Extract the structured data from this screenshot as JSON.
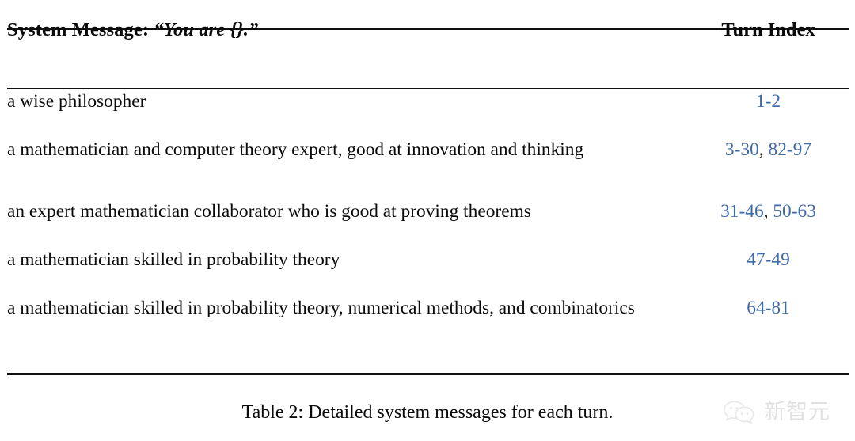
{
  "figure": {
    "caption": "Table 2: Detailed system messages for each turn.",
    "accent_color": "#3f6aa8",
    "rule_color": "#101010"
  },
  "table": {
    "headers": {
      "message_prefix": "System Message: ",
      "message_quoted": "“You are {}.”",
      "turn_index": "Turn Index"
    },
    "rows": [
      {
        "message": "a wise philosopher",
        "turn_index": "1-2",
        "turn_parts": [
          {
            "text": "1-2",
            "link": true
          }
        ]
      },
      {
        "message": "a mathematician and computer theory expert, good at innovation and thinking",
        "turn_index": "3-30, 82-97",
        "turn_parts": [
          {
            "text": "3-30",
            "link": true
          },
          {
            "text": ", ",
            "link": false
          },
          {
            "text": "82-97",
            "link": true
          }
        ]
      },
      {
        "message": "an expert mathematician collaborator who is good at proving theorems",
        "turn_index": "31-46, 50-63",
        "turn_parts": [
          {
            "text": "31-46",
            "link": true
          },
          {
            "text": ", ",
            "link": false
          },
          {
            "text": "50-63",
            "link": true
          }
        ]
      },
      {
        "message": "a mathematician skilled in probability theory",
        "turn_index": "47-49",
        "turn_parts": [
          {
            "text": "47-49",
            "link": true
          }
        ]
      },
      {
        "message": "a mathematician skilled in probability theory, numerical methods, and combinatorics",
        "turn_index": "64-81",
        "turn_parts": [
          {
            "text": "64-81",
            "link": true
          }
        ]
      }
    ]
  },
  "watermark": {
    "text": "新智元",
    "icon": "chat-bubbles-icon",
    "color": "#9a9a9a"
  }
}
